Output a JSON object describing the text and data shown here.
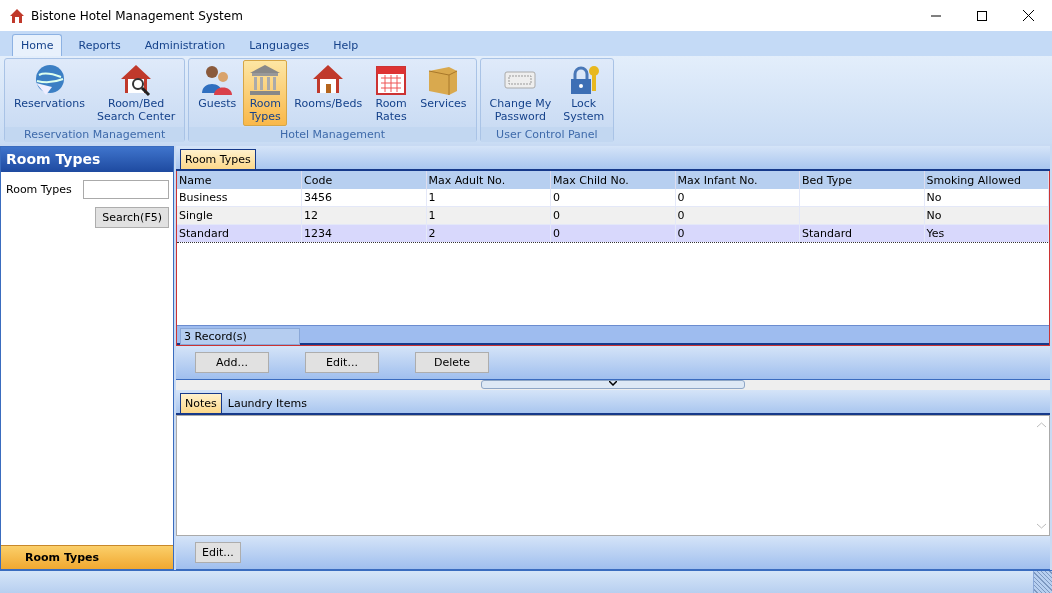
{
  "window": {
    "title": "Bistone Hotel Management System"
  },
  "menu_tabs": [
    {
      "label": "Home",
      "selected": true
    },
    {
      "label": "Reports",
      "selected": false
    },
    {
      "label": "Administration",
      "selected": false
    },
    {
      "label": "Languages",
      "selected": false
    },
    {
      "label": "Help",
      "selected": false
    }
  ],
  "ribbon_groups": [
    {
      "title": "Reservation Management",
      "buttons": [
        {
          "label": "Reservations",
          "selected": false
        },
        {
          "label": "Room/Bed\nSearch Center",
          "selected": false
        }
      ]
    },
    {
      "title": "Hotel Management",
      "buttons": [
        {
          "label": "Guests",
          "selected": false
        },
        {
          "label": "Room\nTypes",
          "selected": true
        },
        {
          "label": "Rooms/Beds",
          "selected": false
        },
        {
          "label": "Room\nRates",
          "selected": false
        },
        {
          "label": "Services",
          "selected": false
        }
      ]
    },
    {
      "title": "User Control Panel",
      "buttons": [
        {
          "label": "Change My\nPassword",
          "selected": false
        },
        {
          "label": "Lock\nSystem",
          "selected": false
        }
      ]
    }
  ],
  "sidebar": {
    "title": "Room Types",
    "field_label": "Room Types",
    "search_button": "Search(F5)",
    "footer": "Room Types"
  },
  "grid_tab": {
    "label": "Room Types",
    "selected": true
  },
  "table": {
    "columns": [
      "Name",
      "Code",
      "Max Adult No.",
      "Max Child No.",
      "Max Infant No.",
      "Bed Type",
      "Smoking Allowed"
    ],
    "rows": [
      {
        "cells": [
          "Business",
          "3456",
          "1",
          "0",
          "0",
          "",
          "No"
        ],
        "selected": false
      },
      {
        "cells": [
          "Single",
          "12",
          "1",
          "0",
          "0",
          "",
          "No"
        ],
        "selected": false
      },
      {
        "cells": [
          "Standard",
          "1234",
          "2",
          "0",
          "0",
          "Standard",
          "Yes"
        ],
        "selected": true
      }
    ],
    "record_count": "3 Record(s)"
  },
  "grid_buttons": [
    "Add...",
    "Edit...",
    "Delete"
  ],
  "bottom_tabs": [
    {
      "label": "Notes",
      "selected": true
    },
    {
      "label": "Laundry Items",
      "selected": false
    }
  ],
  "notes_button": "Edit..."
}
